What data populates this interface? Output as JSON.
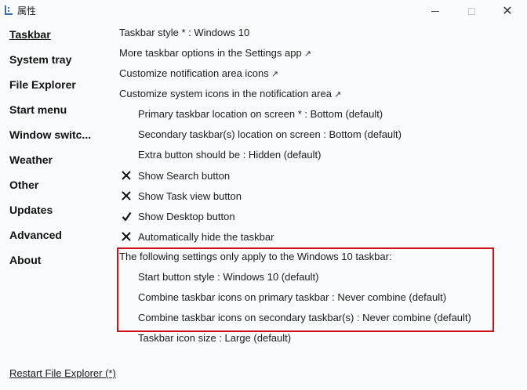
{
  "window": {
    "title": "属性",
    "close_glyph": "✕"
  },
  "sidebar": {
    "items": [
      {
        "label": "Taskbar",
        "active": true
      },
      {
        "label": "System tray"
      },
      {
        "label": "File Explorer"
      },
      {
        "label": "Start menu"
      },
      {
        "label": "Window switc..."
      },
      {
        "label": "Weather"
      },
      {
        "label": "Other"
      },
      {
        "label": "Updates"
      },
      {
        "label": "Advanced"
      },
      {
        "label": "About"
      }
    ],
    "restart_link": "Restart File Explorer (*)"
  },
  "main": {
    "taskbar_style": "Taskbar style * : Windows 10",
    "more_options": "More taskbar options in the Settings app",
    "customize_notification": "Customize notification area icons",
    "customize_system_icons": "Customize system icons in the notification area",
    "external_arrow": "↗",
    "primary_location": "Primary taskbar location on screen * : Bottom (default)",
    "secondary_location": "Secondary taskbar(s) location on screen : Bottom (default)",
    "extra_button": "Extra button should be : Hidden (default)",
    "toggles": [
      {
        "label": "Show Search button",
        "checked": false
      },
      {
        "label": "Show Task view button",
        "checked": false
      },
      {
        "label": "Show Desktop button",
        "checked": true
      },
      {
        "label": "Automatically hide the taskbar",
        "checked": false
      }
    ],
    "win10_note": "The following settings only apply to the Windows 10 taskbar:",
    "start_button_style": "Start button style : Windows 10 (default)",
    "combine_primary": "Combine taskbar icons on primary taskbar : Never combine (default)",
    "combine_secondary": "Combine taskbar icons on secondary taskbar(s) : Never combine (default)",
    "icon_size": "Taskbar icon size : Large (default)"
  },
  "colors": {
    "highlight_border": "#d10f18",
    "background": "#fafbfc"
  }
}
